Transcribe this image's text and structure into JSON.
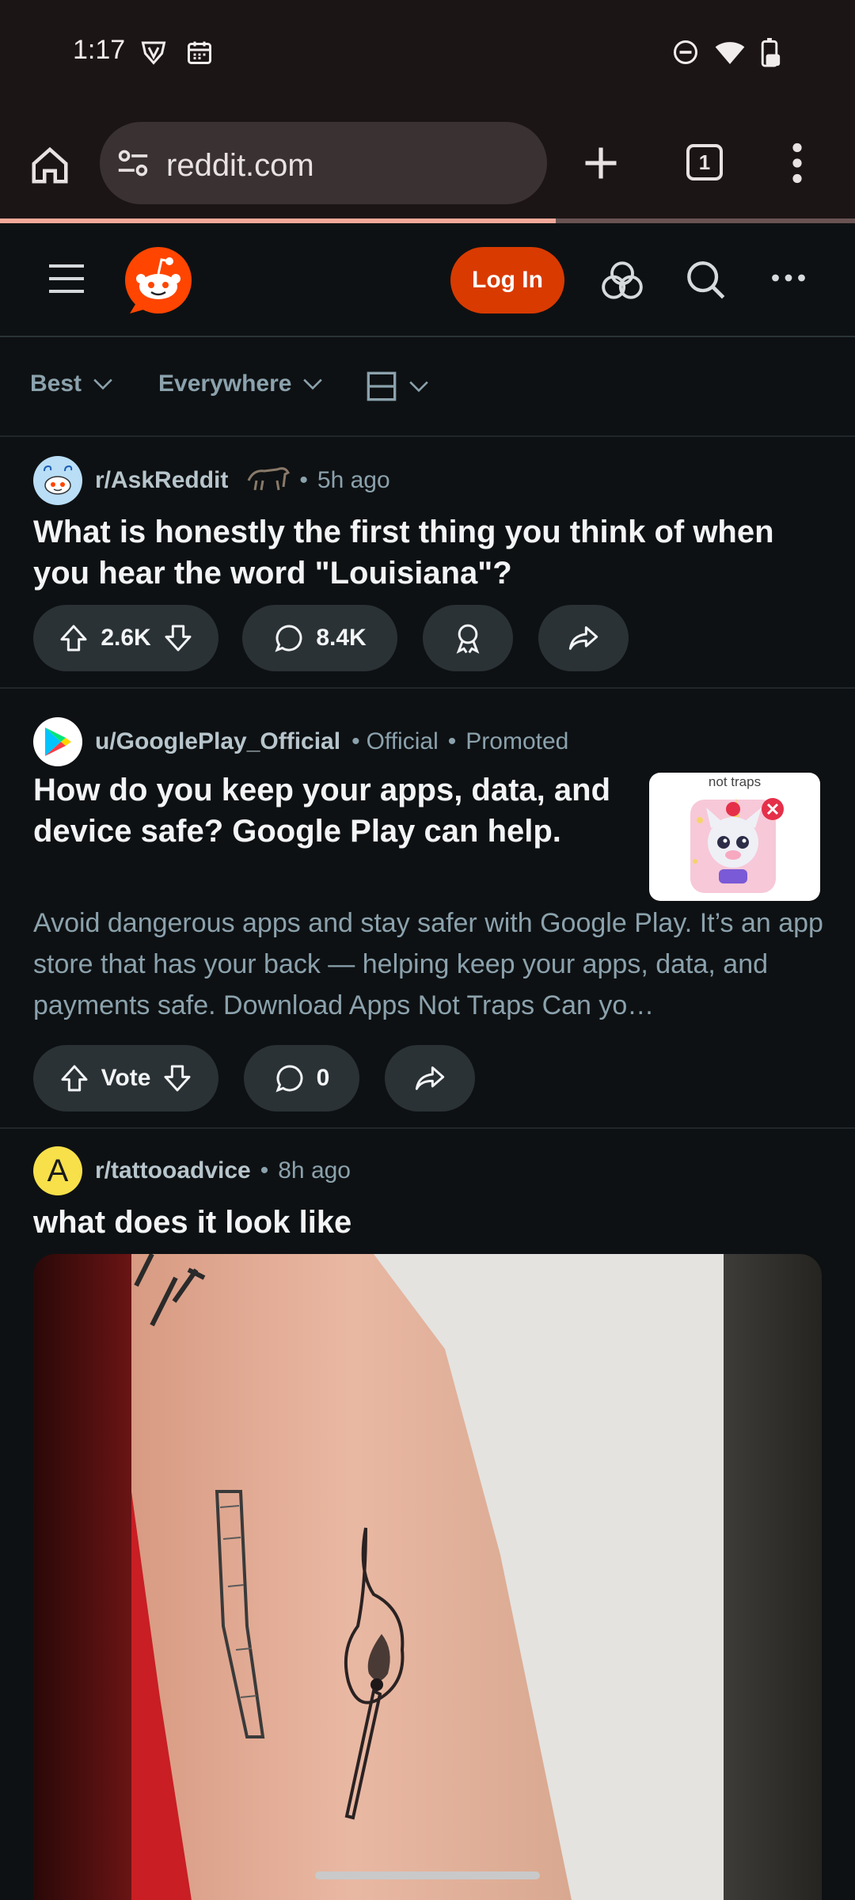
{
  "status_bar": {
    "time": "1:17"
  },
  "browser": {
    "url": "reddit.com",
    "tab_count": "1",
    "load_progress_fraction": 0.65
  },
  "header": {
    "login_label": "Log In"
  },
  "filters": {
    "sort": "Best",
    "scope": "Everywhere"
  },
  "posts": [
    {
      "subreddit": "r/AskReddit",
      "time": "5h ago",
      "title": "What is honestly the first thing you think of when you hear the word \"Louisiana\"?",
      "upvotes": "2.6K",
      "comments": "8.4K"
    },
    {
      "author": "u/GooglePlay_Official",
      "official": "Official",
      "promoted": "Promoted",
      "title": "How do you keep your apps, data, and device safe? Google Play can help.",
      "body": "Avoid dangerous apps and stay safer with Google Play. It’s an app store that has your back — helping keep your apps, data, and payments safe. Download Apps Not Traps Can yo…",
      "vote_label": "Vote",
      "comments": "0",
      "thumb_text": "not traps"
    },
    {
      "avatar_letter": "A",
      "subreddit": "r/tattooadvice",
      "time": "8h ago",
      "title": "what does it look like"
    }
  ],
  "colors": {
    "accent": "#d93a00",
    "background": "#0e1113",
    "pill": "#2a3236",
    "browser_chrome": "#1c1516"
  }
}
